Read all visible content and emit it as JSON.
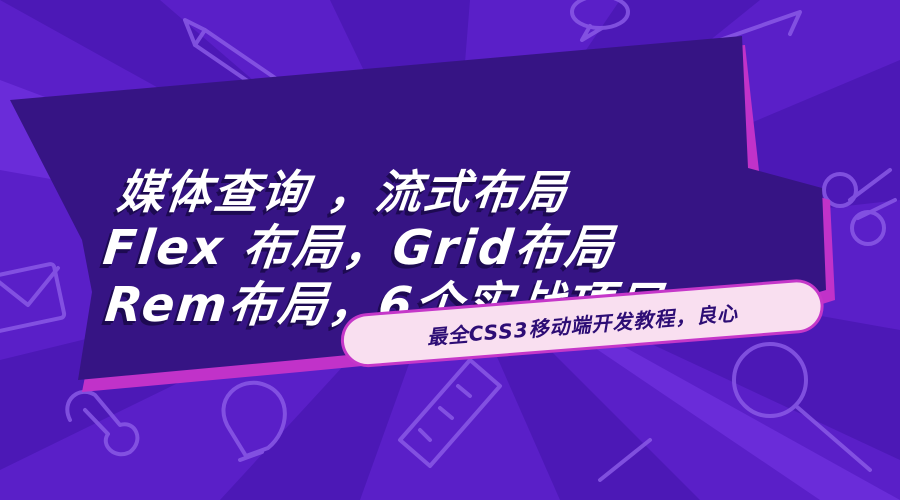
{
  "colors": {
    "background": "#5a1fc8",
    "ray_dark": "#4a17b3",
    "ray_light": "#6b2fd8",
    "banner_fill": "#361484",
    "banner_shadow": "#c132c9",
    "title_text": "#ffffff",
    "pill_fill": "#f9dff0",
    "pill_text": "#2d0d75"
  },
  "title": {
    "line1": "媒体查询 ，流式布局",
    "line2": "Flex 布局，Grid布局",
    "line3": "Rem布局，6个实战项目"
  },
  "subtitle": "最全CSS3移动端开发教程，良心",
  "doodles": [
    "pencil-icon",
    "envelope-icon",
    "wrench-icon",
    "magnifier-icon",
    "lightbulb-icon",
    "ruler-icon",
    "chat-bubble-icon",
    "scissors-icon",
    "arrow-icon"
  ]
}
